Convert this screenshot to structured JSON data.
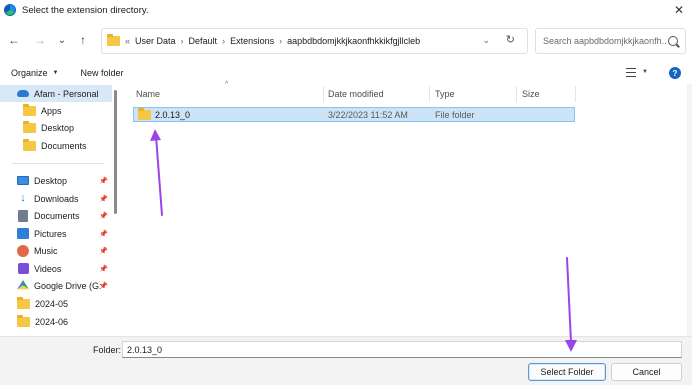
{
  "window": {
    "title": "Select the extension directory.",
    "close_glyph": "✕"
  },
  "nav": {
    "back_glyph": "←",
    "forward_glyph": "→",
    "recent_glyph": "⌄",
    "up_glyph": "↑",
    "breadcrumb_prefix": "«",
    "breadcrumb": [
      "User Data",
      "Default",
      "Extensions",
      "aapbdbdomjkkjkaonfhkkikfgjllcleb"
    ],
    "breadcrumb_sep": "›",
    "dropdown_glyph": "⌄",
    "refresh_glyph": "↻",
    "search_placeholder": "Search aapbdbdomjkkjkaonfh..."
  },
  "commands": {
    "organize": "Organize",
    "organize_caret": "▼",
    "new_folder": "New folder",
    "view_caret": "▼",
    "help": "?"
  },
  "sidebar": {
    "pin_glyph": "📌",
    "top": {
      "label": "Afam - Personal",
      "icon": "onedrive-cloud-icon"
    },
    "cloud_items": [
      {
        "label": "Apps",
        "icon": "folder-icon"
      },
      {
        "label": "Desktop",
        "icon": "folder-icon"
      },
      {
        "label": "Documents",
        "icon": "folder-icon"
      }
    ],
    "quick_access": [
      {
        "label": "Desktop",
        "icon": "desktop-icon",
        "pinned": true
      },
      {
        "label": "Downloads",
        "icon": "download-icon",
        "pinned": true
      },
      {
        "label": "Documents",
        "icon": "documents-icon",
        "pinned": true
      },
      {
        "label": "Pictures",
        "icon": "pictures-icon",
        "pinned": true
      },
      {
        "label": "Music",
        "icon": "music-icon",
        "pinned": true
      },
      {
        "label": "Videos",
        "icon": "videos-icon",
        "pinned": true
      },
      {
        "label": "Google Drive (G:",
        "icon": "google-drive-icon",
        "pinned": true
      },
      {
        "label": "2024-05",
        "icon": "folder-icon",
        "pinned": false
      },
      {
        "label": "2024-06",
        "icon": "folder-icon",
        "pinned": false
      }
    ]
  },
  "columns": {
    "sort_glyph": "^",
    "name": "Name",
    "date": "Date modified",
    "type": "Type",
    "size": "Size"
  },
  "files": [
    {
      "name": "2.0.13_0",
      "date": "3/22/2023 11:52 AM",
      "type": "File folder",
      "size": ""
    }
  ],
  "footer": {
    "folder_label": "Folder:",
    "folder_value": "2.0.13_0",
    "select_button": "Select Folder",
    "cancel_button": "Cancel"
  },
  "colors": {
    "annotation_arrow": "#9b45e8",
    "selection": "#cce4f7",
    "accent": "#1565c0"
  }
}
